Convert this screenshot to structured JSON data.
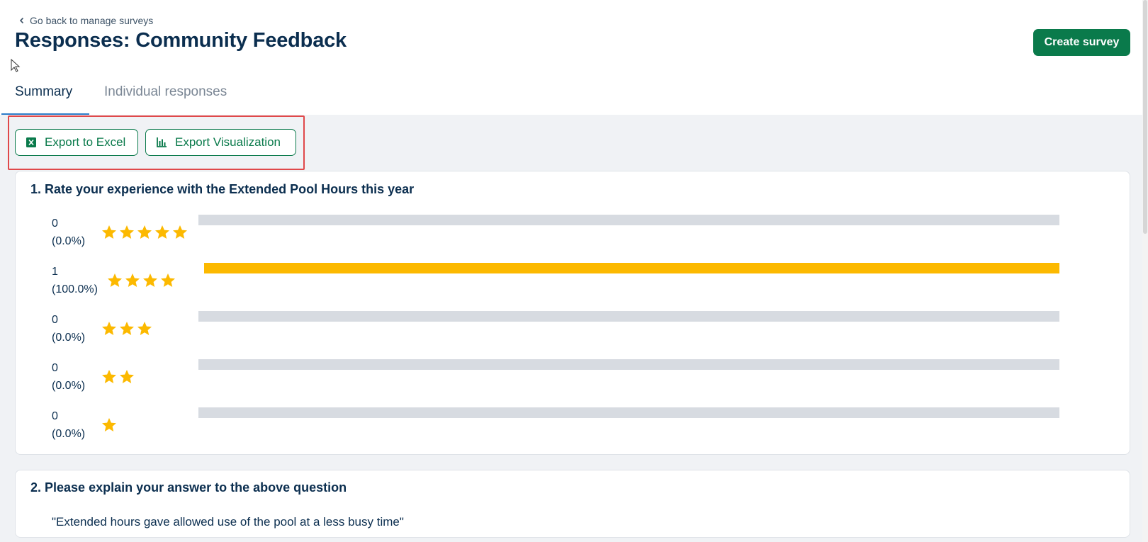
{
  "header": {
    "back_label": "Go back to manage surveys",
    "title": "Responses: Community Feedback",
    "create_label": "Create survey"
  },
  "tabs": [
    {
      "label": "Summary",
      "active": true
    },
    {
      "label": "Individual responses",
      "active": false
    }
  ],
  "toolbar": {
    "excel_label": "Export to Excel",
    "excel_icon": "excel-icon",
    "viz_label": "Export Visualization",
    "viz_icon": "bar-chart-icon"
  },
  "questions": [
    {
      "title": "1. Rate your experience with the Extended Pool Hours this year",
      "ratings": [
        {
          "stars": 5,
          "count": "0",
          "percent": "(0.0%)",
          "fraction": 0
        },
        {
          "stars": 4,
          "count": "1",
          "percent": "(100.0%)",
          "fraction": 1
        },
        {
          "stars": 3,
          "count": "0",
          "percent": "(0.0%)",
          "fraction": 0
        },
        {
          "stars": 2,
          "count": "0",
          "percent": "(0.0%)",
          "fraction": 0
        },
        {
          "stars": 1,
          "count": "0",
          "percent": "(0.0%)",
          "fraction": 0
        }
      ]
    },
    {
      "title": "2. Please explain your answer to the above question",
      "answers": [
        "\"Extended hours gave allowed use of the pool at a less busy time\""
      ]
    }
  ],
  "colors": {
    "primary": "#0a7a4b",
    "title": "#0b2e4f",
    "star": "#fcb900",
    "track": "#d7dbe1",
    "tab_underline": "#2b7cc9",
    "highlight": "#e0484a"
  }
}
